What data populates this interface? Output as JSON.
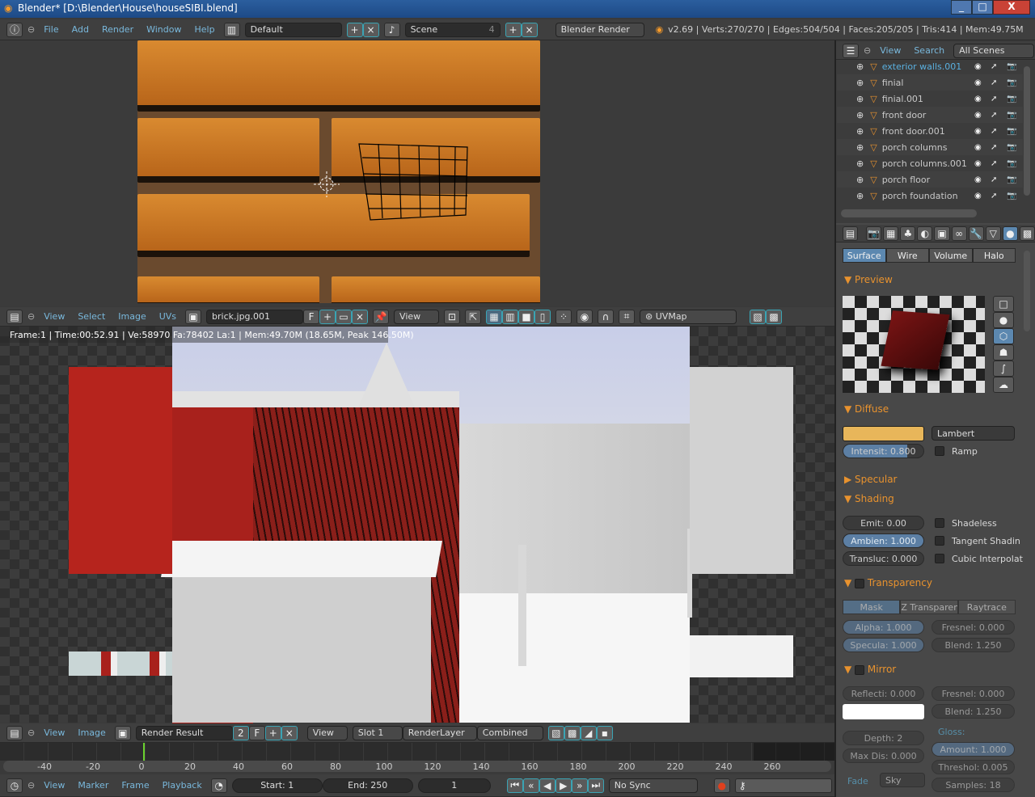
{
  "window": {
    "title": "Blender* [D:\\Blender\\House\\houseSIBI.blend]",
    "min": "_",
    "max": "□",
    "close": "X"
  },
  "info_header": {
    "menus": [
      "File",
      "Add",
      "Render",
      "Window",
      "Help"
    ],
    "layout": "Default",
    "scene": "Scene",
    "scene_users": "4",
    "engine": "Blender Render",
    "stats": "v2.69 | Verts:270/270 | Edges:504/504 | Faces:205/205 | Tris:414 | Mem:49.75M"
  },
  "uv_header": {
    "menus": [
      "View",
      "Select",
      "Image",
      "UVs"
    ],
    "image": "brick.jpg.001",
    "fake": "F",
    "view": "View",
    "uvmap": "UVMap"
  },
  "render_info": "Frame:1 | Time:00:52.91 | Ve:58970 Fa:78402 La:1 | Mem:49.70M (18.65M, Peak 146.50M)",
  "image_header": {
    "menus": [
      "View",
      "Image"
    ],
    "image": "Render Result",
    "users": "2",
    "fake": "F",
    "view": "View",
    "slot": "Slot 1",
    "layer": "RenderLayer",
    "pass": "Combined"
  },
  "timeline": {
    "ticks": [
      "-40",
      "-20",
      "0",
      "20",
      "40",
      "60",
      "80",
      "100",
      "120",
      "140",
      "160",
      "180",
      "200",
      "220",
      "240",
      "260"
    ],
    "current_frame_value": 0
  },
  "timeline_header": {
    "menus": [
      "View",
      "Marker",
      "Frame",
      "Playback"
    ],
    "start": "Start: 1",
    "end": "End: 250",
    "frame": "1",
    "sync": "No Sync"
  },
  "outliner": {
    "menus": [
      "View",
      "Search"
    ],
    "filter": "All Scenes",
    "items": [
      {
        "name": "exterior walls.001",
        "selected": true
      },
      {
        "name": "finial"
      },
      {
        "name": "finial.001"
      },
      {
        "name": "front door"
      },
      {
        "name": "front door.001"
      },
      {
        "name": "porch columns"
      },
      {
        "name": "porch columns.001"
      },
      {
        "name": "porch floor"
      },
      {
        "name": "porch foundation"
      }
    ]
  },
  "properties": {
    "tabs": [
      "Surface",
      "Wire",
      "Volume",
      "Halo"
    ],
    "preview": "Preview",
    "diffuse": {
      "title": "Diffuse",
      "color": "#e8b65a",
      "shader": "Lambert",
      "intensity": "Intensit: 0.800",
      "intensity_value": 0.8,
      "ramp": "Ramp"
    },
    "specular": "Specular",
    "shading": {
      "title": "Shading",
      "emit": "Emit: 0.00",
      "ambient": "Ambien: 1.000",
      "transluc": "Transluc: 0.000",
      "shadeless": "Shadeless",
      "tangent": "Tangent Shadin",
      "cubic": "Cubic Interpolat"
    },
    "transparency": {
      "title": "Transparency",
      "modes": [
        "Mask",
        "Z Transparenc",
        "Raytrace"
      ],
      "alpha": "Alpha: 1.000",
      "specula": "Specula: 1.000",
      "fresnel": "Fresnel: 0.000",
      "blend": "Blend: 1.250"
    },
    "mirror": {
      "title": "Mirror",
      "reflect": "Reflecti: 0.000",
      "fresnel": "Fresnel: 0.000",
      "blend": "Blend: 1.250",
      "depth": "Depth: 2",
      "maxdist": "Max Dis: 0.000",
      "gloss": "Gloss:",
      "amount": "Amount: 1.000",
      "threshold": "Threshol: 0.005",
      "samples": "Samples: 18",
      "fade": "Fade",
      "fade_to": "Sky"
    }
  }
}
